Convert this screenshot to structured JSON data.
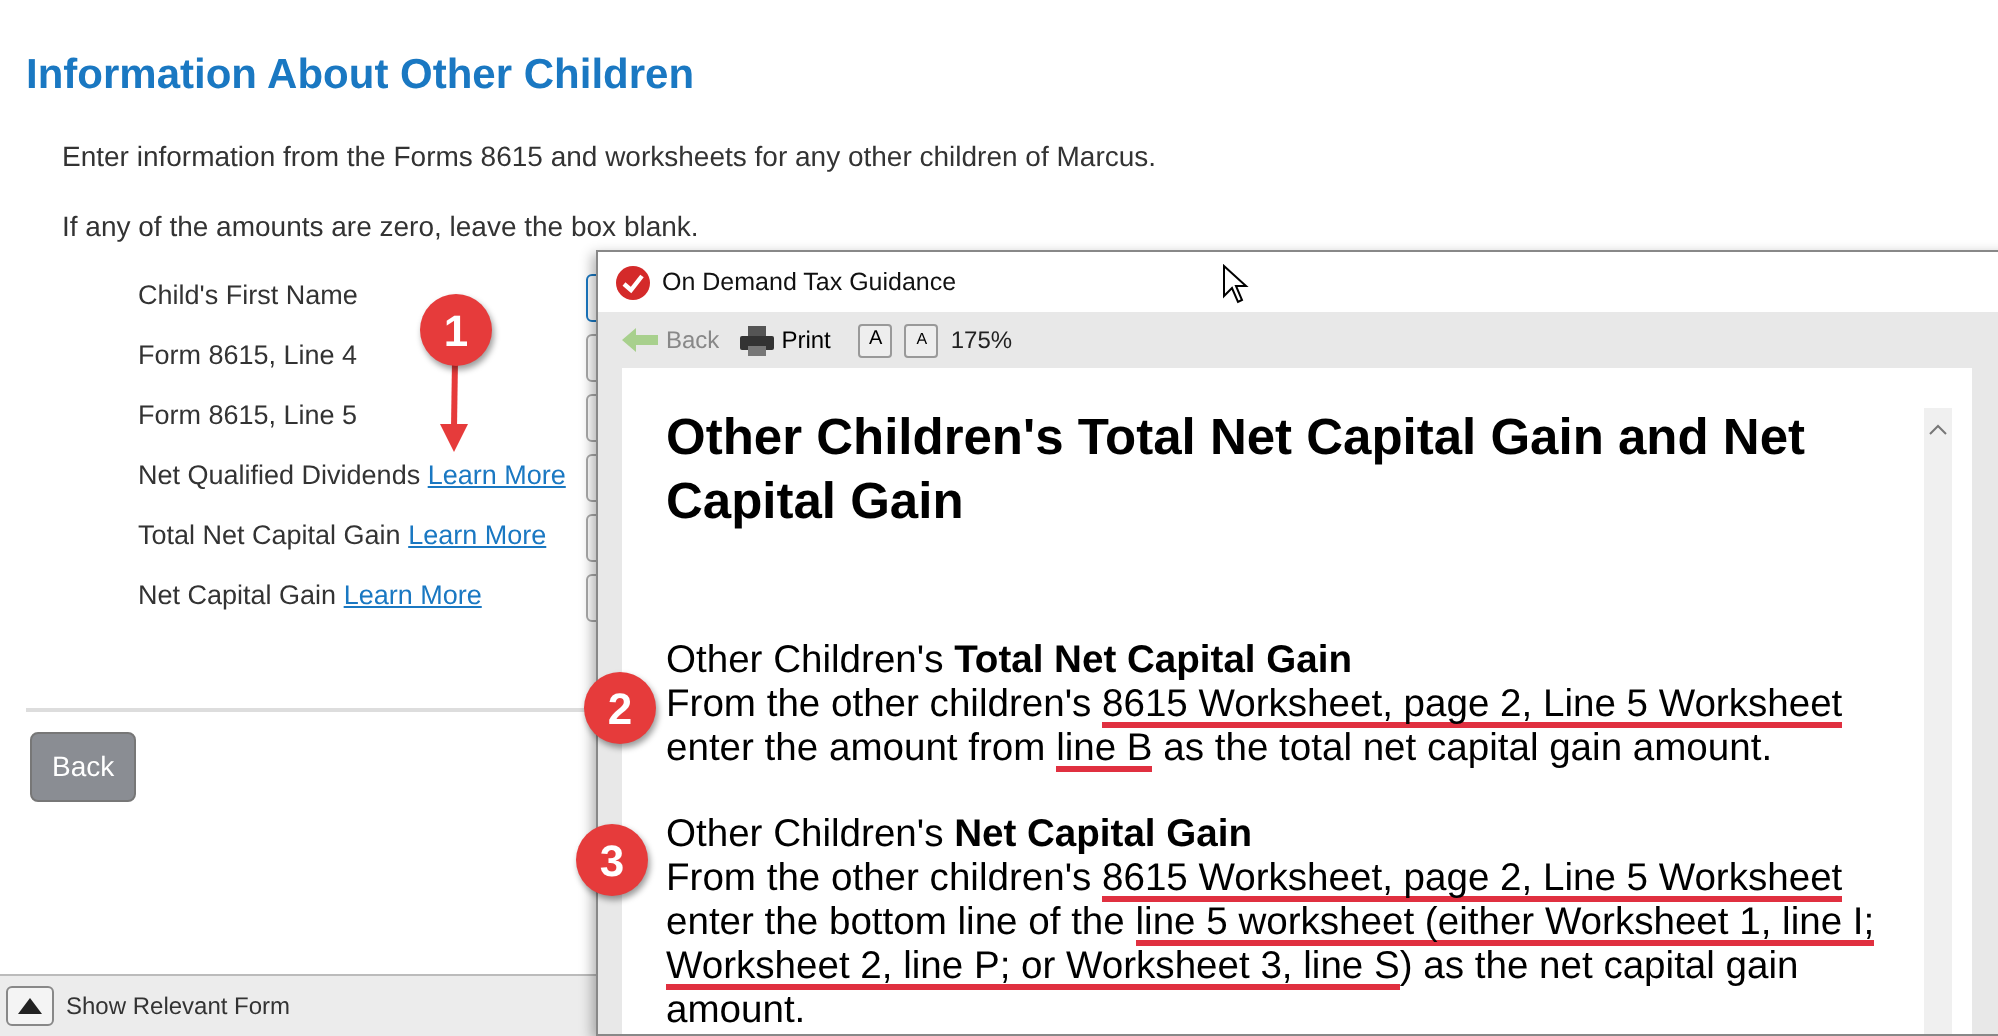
{
  "page": {
    "heading": "Information About Other Children",
    "paragraphs": [
      "Enter information from the Forms 8615 and worksheets for any other children of Marcus.",
      "If any of the amounts are zero, leave the box blank."
    ],
    "fields": [
      {
        "label": "Child's First Name",
        "focused": true
      },
      {
        "label": "Form 8615, Line 4",
        "focused": false
      },
      {
        "label": "Form 8615, Line 5",
        "focused": false
      },
      {
        "label": "Net Qualified Dividends",
        "link": "Learn More",
        "focused": false
      },
      {
        "label": "Total Net Capital Gain",
        "link": "Learn More",
        "focused": false
      },
      {
        "label": "Net Capital Gain",
        "link": "Learn More",
        "focused": false
      }
    ],
    "back_button": "Back",
    "bottom_bar": {
      "label": "Show Relevant Form"
    }
  },
  "dialog": {
    "title": "On Demand Tax Guidance",
    "toolbar": {
      "back": "Back",
      "back_disabled": true,
      "print": "Print",
      "font_buttons": [
        "A",
        "A"
      ],
      "zoom": "175%"
    },
    "heading": "Other Children's Total Net Capital Gain and Net Capital Gain",
    "sections": [
      {
        "title": "Other Children's **Total Net Capital Gain**",
        "segments": [
          {
            "text": "From the other children's ",
            "underlined": false
          },
          {
            "text": "8615 Worksheet, page 2, Line 5 Worksheet",
            "underlined": true
          },
          {
            "text": " enter the amount from ",
            "underlined": false
          },
          {
            "text": "line B",
            "underlined": true
          },
          {
            "text": " as the total net capital gain amount.",
            "underlined": false
          }
        ]
      },
      {
        "title": "Other Children's **Net Capital Gain**",
        "segments": [
          {
            "text": "From the other children's ",
            "underlined": false
          },
          {
            "text": "8615 Worksheet, page 2, Line 5 Worksheet",
            "underlined": true
          },
          {
            "text": " enter the bottom line of the ",
            "underlined": false
          },
          {
            "text": "line 5 worksheet (either Worksheet 1, line I; Worksheet 2, line P; or Worksheet 3, line S",
            "underlined": true
          },
          {
            "text": ") as the net capital gain amount.",
            "underlined": false
          }
        ]
      }
    ]
  },
  "callouts": [
    "1",
    "2",
    "3"
  ]
}
